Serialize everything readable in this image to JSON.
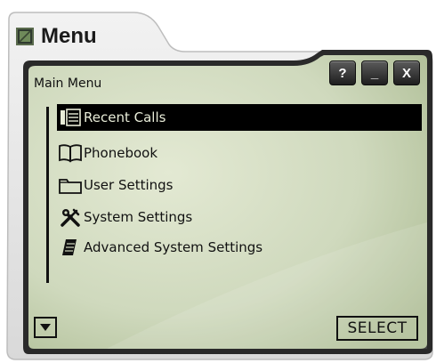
{
  "window": {
    "title": "Menu",
    "buttons": {
      "help": "?",
      "minimize": "_",
      "close": "X"
    }
  },
  "screen": {
    "header": "Main Menu",
    "items": [
      {
        "label": "Recent Calls",
        "icon": "recent-calls-icon",
        "selected": true
      },
      {
        "label": "Phonebook",
        "icon": "phonebook-icon",
        "selected": false
      },
      {
        "label": "User Settings",
        "icon": "folder-icon",
        "selected": false
      },
      {
        "label": "System Settings",
        "icon": "tools-icon",
        "selected": false
      },
      {
        "label": "Advanced System Settings",
        "icon": "advanced-settings-icon",
        "selected": false
      }
    ],
    "select_label": "SELECT"
  },
  "colors": {
    "screen_light": "#dfe6cf",
    "screen_mid": "#c3cfae",
    "frame_dark": "#2a2a2a",
    "selection": "#000000"
  }
}
